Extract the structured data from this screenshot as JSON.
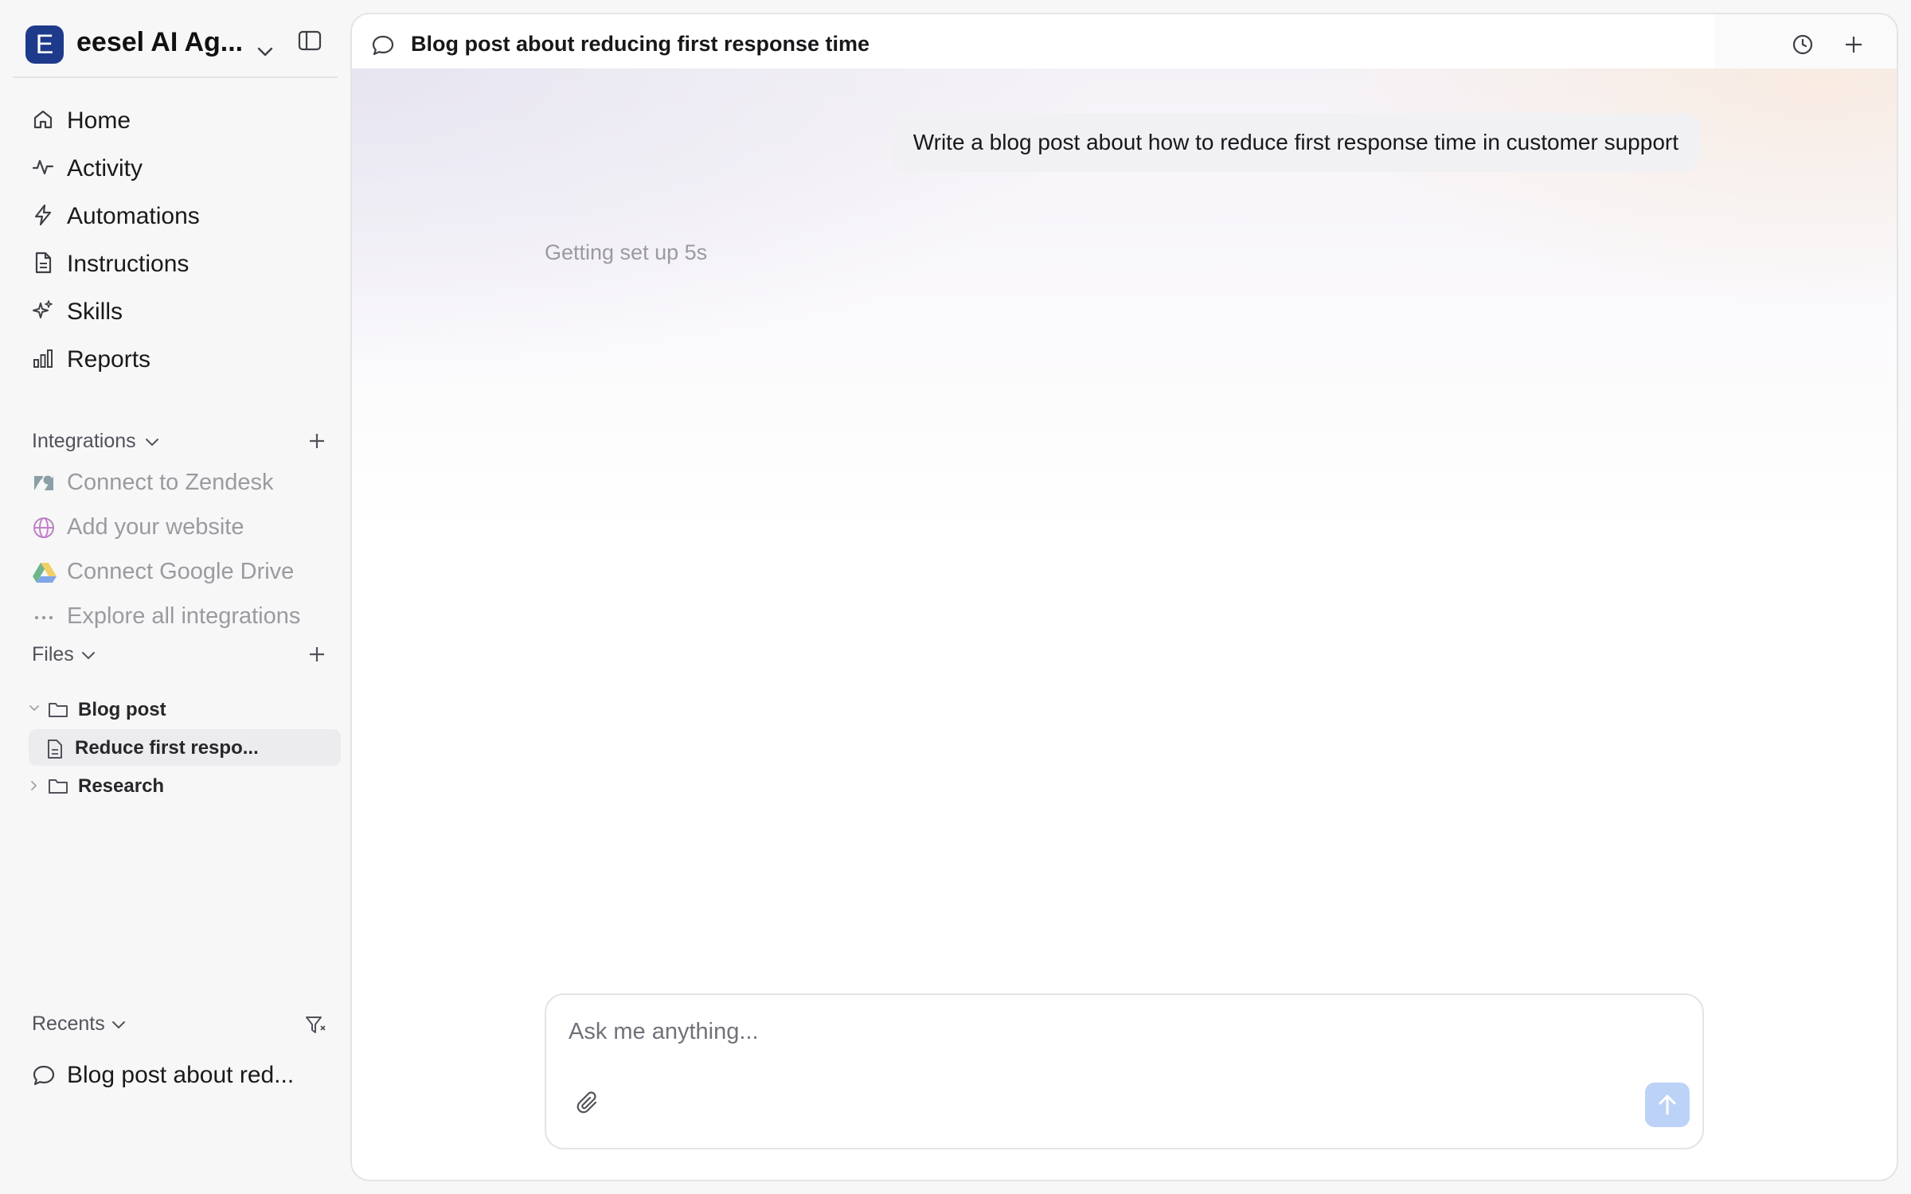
{
  "workspace": {
    "initial": "E",
    "name": "eesel AI Ag...",
    "badge_color": "#1e3a8a"
  },
  "sidebar": {
    "nav": [
      {
        "label": "Home",
        "icon": "home-icon"
      },
      {
        "label": "Activity",
        "icon": "activity-icon"
      },
      {
        "label": "Automations",
        "icon": "lightning-icon"
      },
      {
        "label": "Instructions",
        "icon": "document-icon"
      },
      {
        "label": "Skills",
        "icon": "sparkle-icon"
      },
      {
        "label": "Reports",
        "icon": "bar-chart-icon"
      }
    ],
    "integrations": {
      "title": "Integrations",
      "items": [
        {
          "label": "Connect to Zendesk",
          "icon": "zendesk-icon"
        },
        {
          "label": "Add your website",
          "icon": "globe-icon"
        },
        {
          "label": "Connect Google Drive",
          "icon": "google-drive-icon"
        },
        {
          "label": "Explore all integrations",
          "icon": "ellipsis-icon"
        }
      ]
    },
    "files": {
      "title": "Files",
      "tree": [
        {
          "label": "Blog post",
          "type": "folder",
          "expanded": true
        },
        {
          "label": "Reduce first respo...",
          "type": "file",
          "selected": true
        },
        {
          "label": "Research",
          "type": "folder",
          "expanded": false
        }
      ]
    },
    "recents": {
      "title": "Recents",
      "items": [
        {
          "label": "Blog post about red...",
          "icon": "chat-bubble-icon"
        }
      ]
    }
  },
  "main": {
    "title": "Blog post about reducing first response time",
    "user_message": "Write a blog post about how to reduce first response time in customer support",
    "status": "Getting set up 5s",
    "composer": {
      "placeholder": "Ask me anything...",
      "value": "",
      "send_color": "#bcd2f7"
    }
  }
}
